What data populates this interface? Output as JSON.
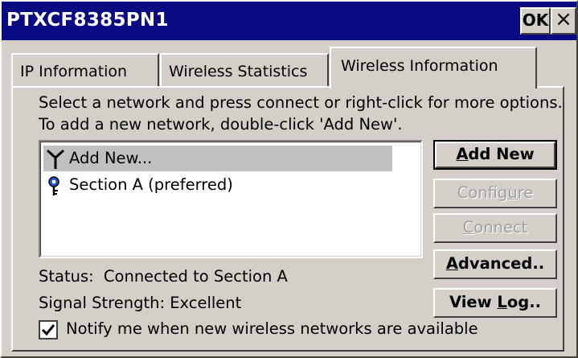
{
  "window": {
    "title": "PTXCF8385PN1",
    "ok_label": "OK",
    "close_label": "×"
  },
  "tabs": [
    {
      "label": "IP Information",
      "active": false
    },
    {
      "label": "Wireless Statistics",
      "active": false
    },
    {
      "label": "Wireless Information",
      "active": true
    }
  ],
  "instructions": "Select a network and press connect or right-click for more options.  To add a new network, double-click 'Add New'.",
  "networks": [
    {
      "label": "Add New...",
      "icon": "antenna-icon",
      "selected": true
    },
    {
      "label": "Section A (preferred)",
      "icon": "connected-network-icon",
      "selected": false
    }
  ],
  "buttons": {
    "add_new": {
      "pre": "",
      "ul": "A",
      "post": "dd New"
    },
    "configure": {
      "pre": "Config",
      "ul": "u",
      "post": "re"
    },
    "connect": {
      "pre": "",
      "ul": "C",
      "post": "onnect"
    },
    "advanced": {
      "pre": "",
      "ul": "A",
      "post": "dvanced.."
    },
    "view_log": {
      "pre": "View ",
      "ul": "L",
      "post": "og.."
    }
  },
  "status": {
    "label": "Status:",
    "value": "Connected to Section A"
  },
  "signal": {
    "label": "Signal Strength:",
    "value": "Excellent"
  },
  "notify": {
    "checked": true,
    "label": "Notify me when new wireless networks are available"
  }
}
